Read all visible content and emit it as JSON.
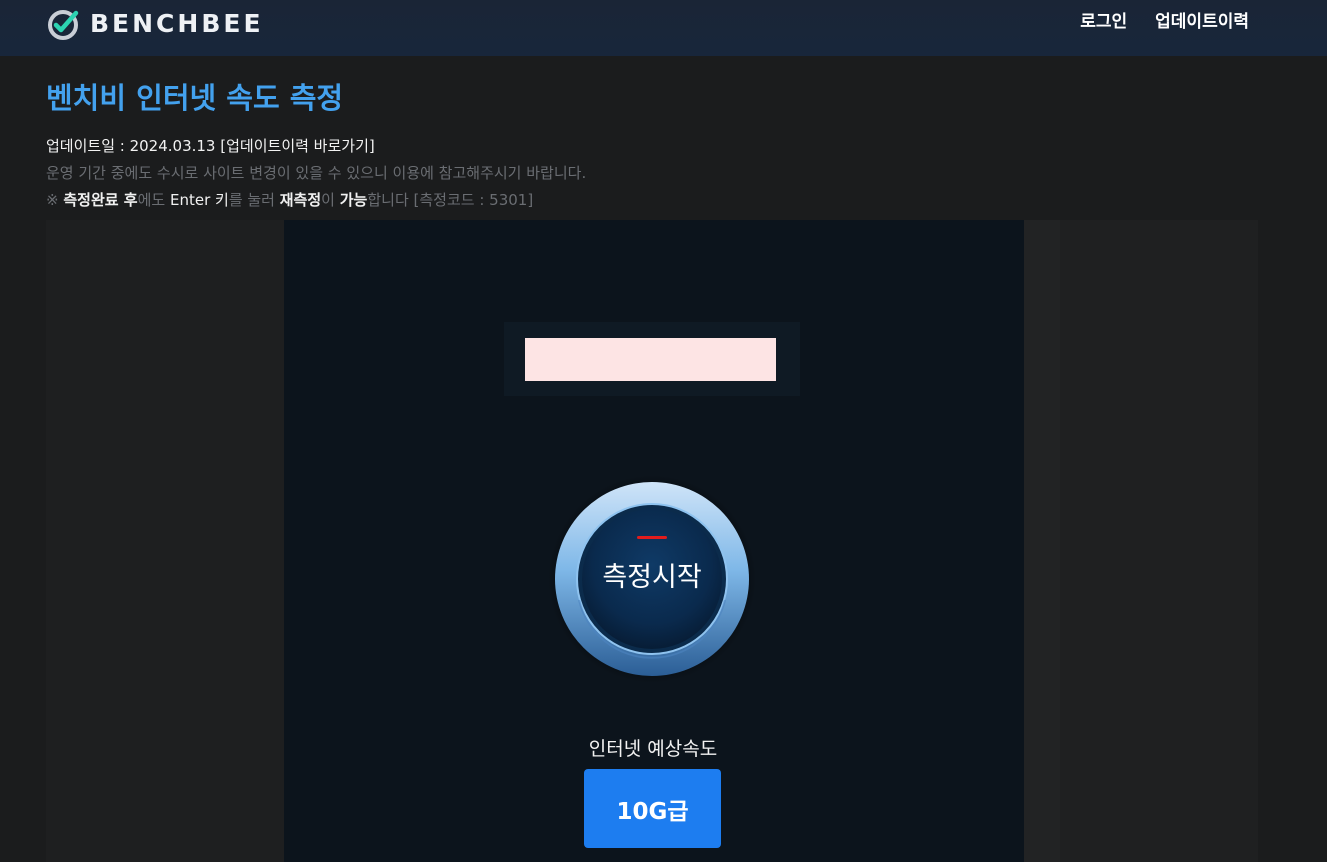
{
  "header": {
    "logo_text": "BENCHBEE",
    "nav": {
      "login": "로그인",
      "update_history": "업데이트이력"
    }
  },
  "intro": {
    "title": "벤치비 인터넷 속도 측정",
    "update_date": "업데이트일 : 2024.03.13",
    "update_link": "[업데이트이력 바로가기]",
    "notice": "운영 기간 중에도 수시로 사이트 변경이 있을 수 있으니 이용에 참고해주시기 바랍니다.",
    "hint": {
      "mark": "※",
      "part1": "측정완료 후",
      "part2": "에도 ",
      "part3": "Enter 키",
      "part4": "를 눌러 ",
      "part5": "재측정",
      "part6": "이 ",
      "part7": "가능",
      "part8": "합니다 [측정코드 : 5301]"
    }
  },
  "main": {
    "server_input": {
      "value": "",
      "placeholder": ""
    },
    "start_button": "측정시작",
    "expected_speed_label": "인터넷 예상속도",
    "expected_speed_value": "10G급"
  },
  "colors": {
    "accent_blue": "#43a1ee",
    "button_blue": "#1d7df0",
    "input_bg": "#fde4e4",
    "indicator_red": "#e21c1c"
  },
  "icons": {
    "logo": "gauge-check-icon"
  }
}
